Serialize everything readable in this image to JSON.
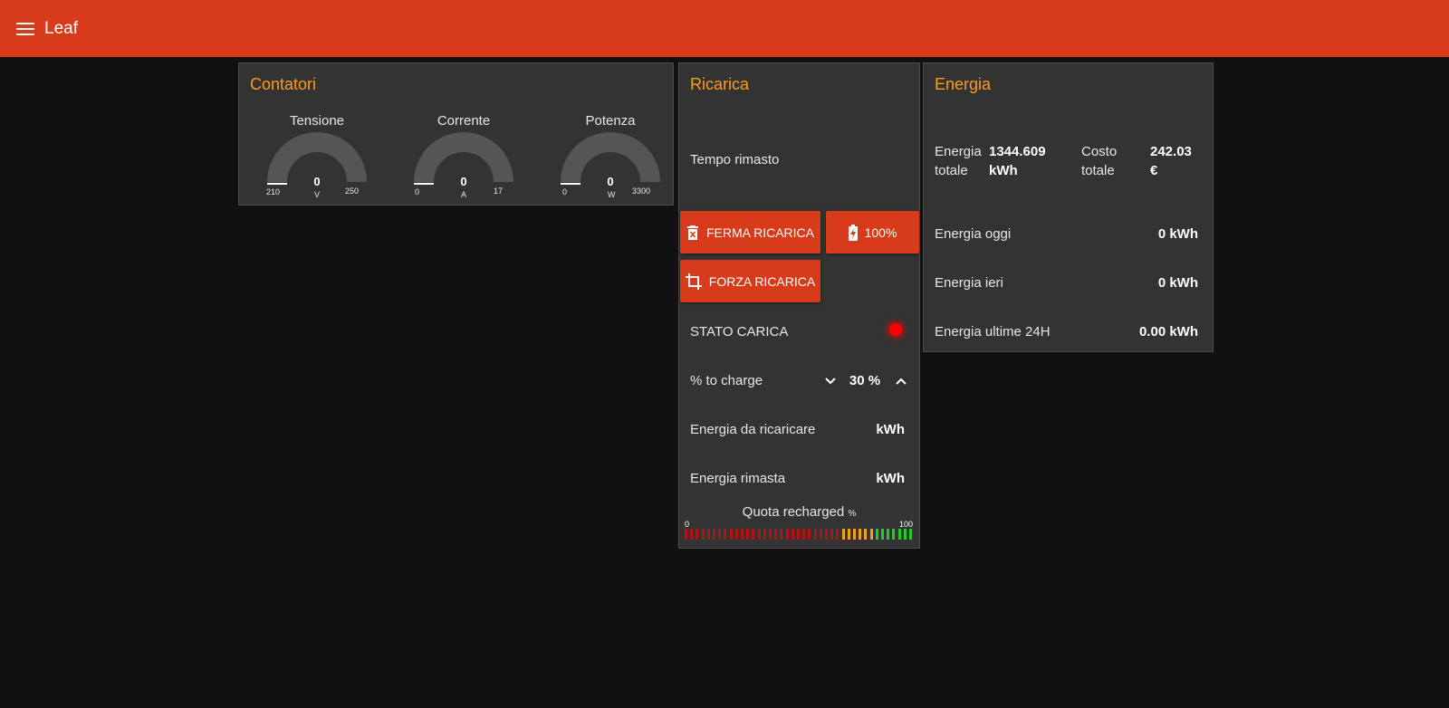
{
  "app": {
    "title": "Leaf"
  },
  "contatori": {
    "title": "Contatori",
    "gauges": [
      {
        "label": "Tensione",
        "value": "0",
        "unit": "V",
        "min": "210",
        "max": "250",
        "level": 0
      },
      {
        "label": "Corrente",
        "value": "0",
        "unit": "A",
        "min": "0",
        "max": "17",
        "level": 0
      },
      {
        "label": "Potenza",
        "value": "0",
        "unit": "W",
        "min": "0",
        "max": "3300",
        "level": 0
      }
    ]
  },
  "ricarica": {
    "title": "Ricarica",
    "tempo_label": "Tempo rimasto",
    "stop_label": "FERMA RICARICA",
    "full_label": "100%",
    "force_label": "FORZA RICARICA",
    "stato_label": "STATO CARICA",
    "stato_color": "#ff0000",
    "to_charge_label": "% to charge",
    "to_charge_value": "30 %",
    "energia_da_ricaricare_label": "Energia da ricaricare",
    "energia_da_ricaricare_value": "kWh",
    "energia_rimasta_label": "Energia rimasta",
    "energia_rimasta_value": "kWh",
    "quota_label": "Quota recharged",
    "quota_unit": "%",
    "quota_min": "0",
    "quota_max": "100"
  },
  "energia": {
    "title": "Energia",
    "totale_label_1": "Energia",
    "totale_label_2": "totale",
    "totale_value_1": "1344.609",
    "totale_value_2": "kWh",
    "costo_label_1": "Costo",
    "costo_label_2": "totale",
    "costo_value_1": "242.03",
    "costo_value_2": "€",
    "oggi_label": "Energia oggi",
    "oggi_value": "0 kWh",
    "ieri_label": "Energia ieri",
    "ieri_value": "0 kWh",
    "ultime_label": "Energia ultime 24H",
    "ultime_value": "0.00 kWh"
  },
  "colors": {
    "accent": "#d83b19",
    "title": "#ff9c1a",
    "card": "#333333",
    "background": "#111111"
  }
}
